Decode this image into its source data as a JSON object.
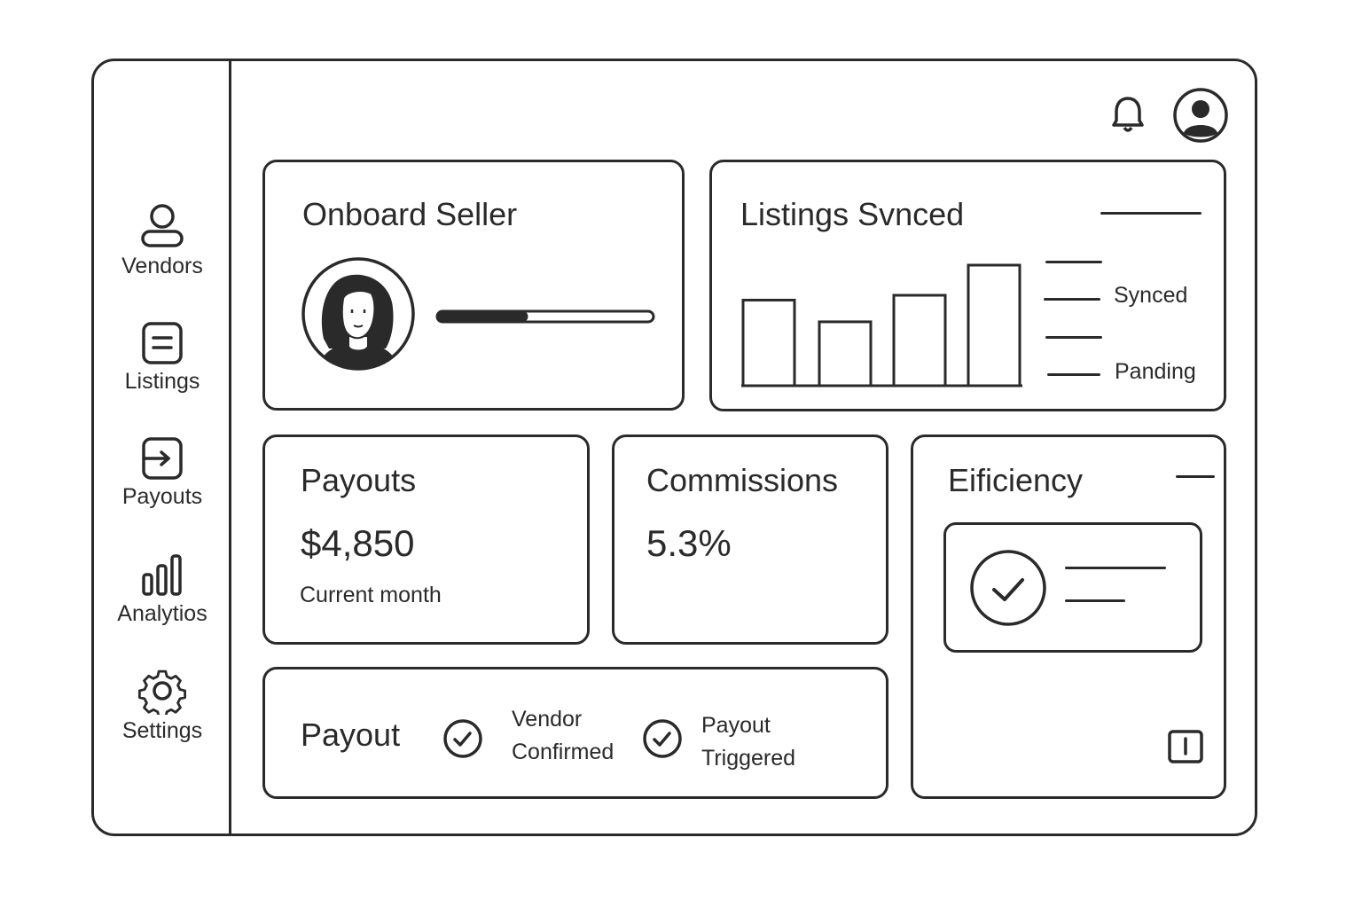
{
  "sidebar": {
    "items": [
      {
        "label": "Vendors",
        "icon": "user-icon"
      },
      {
        "label": "Listings",
        "icon": "document-icon"
      },
      {
        "label": "Payouts",
        "icon": "payout-icon"
      },
      {
        "label": "Analytios",
        "icon": "bar-chart-icon"
      },
      {
        "label": "Settings",
        "icon": "gear-icon"
      }
    ]
  },
  "header": {
    "icons": [
      "bell-icon",
      "avatar-icon"
    ]
  },
  "onboard": {
    "title": "Onboard Seller",
    "progress": 0.42
  },
  "listings": {
    "title": "Listings Svnced",
    "legend": [
      "Synced",
      "Panding"
    ]
  },
  "chart_data": {
    "type": "bar",
    "values": [
      0.71,
      0.53,
      0.75,
      1.0
    ],
    "note": "values are relative bar heights; axis has no printed labels"
  },
  "payouts": {
    "title": "Payouts",
    "value": "$4,850",
    "caption": "Current month"
  },
  "commissions": {
    "title": "Commissions",
    "value": "5.3%"
  },
  "efficiency": {
    "title": "Eificiency"
  },
  "payout_steps": {
    "title": "Payout",
    "steps": [
      {
        "line1": "Vendor",
        "line2": "Confirmed"
      },
      {
        "line1": "Payout",
        "line2": "Triggered"
      }
    ]
  },
  "colors": {
    "stroke": "#2a2a2a",
    "background": "#ffffff"
  }
}
